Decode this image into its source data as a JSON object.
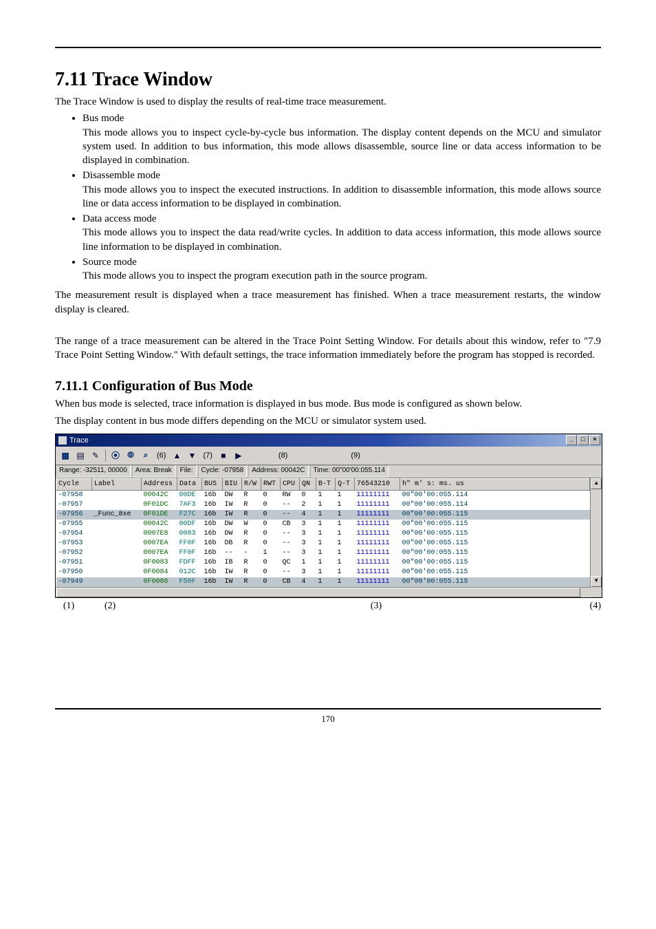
{
  "section": {
    "title": "7.11 Trace Window",
    "intro": "The Trace Window is used to display the results of real-time trace measurement.",
    "modes": [
      {
        "name": "Bus mode",
        "desc": "This mode allows you to inspect cycle-by-cycle bus information. The display content depends on the MCU and simulator system used. In addition to bus information, this mode allows disassemble, source line or data access information to be displayed in combination."
      },
      {
        "name": "Disassemble mode",
        "desc": "This mode allows you to inspect the executed instructions. In addition to disassemble information, this mode allows source line or data access information to be displayed in combination."
      },
      {
        "name": "Data access mode",
        "desc": "This mode allows you to inspect the data read/write cycles. In addition to data access information, this mode allows source line information to be displayed in combination."
      },
      {
        "name": "Source mode",
        "desc": "This mode allows you to inspect the program execution path in the source program."
      }
    ],
    "para2": "The measurement result is displayed when a trace measurement has finished. When a trace measurement restarts, the window display is cleared.",
    "para3": "The range of a trace measurement can be altered in the Trace Point Setting Window. For details about this window, refer to \"7.9 Trace Point Setting Window.\" With default settings, the trace information immediately before the program has stopped is recorded."
  },
  "subsection": {
    "title": "7.11.1 Configuration of Bus Mode",
    "p1": "When bus mode is selected, trace information is displayed in bus mode. Bus mode is configured as shown below.",
    "p2": "The display content in bus mode differs depending on the MCU or simulator system used."
  },
  "trace": {
    "title": "Trace",
    "winbtn_min": "_",
    "winbtn_max": "□",
    "winbtn_close": "×",
    "toolbar_callouts": {
      "left": "(6)",
      "r1": "(7)",
      "r2": "(8)",
      "r3": "(9)"
    },
    "status": {
      "range": "Range: -32511, 00000",
      "area": "Area: Break",
      "file": "File:",
      "cycle": "Cycle: -07958",
      "address": "Address: 00042C",
      "time": "Time: 00\"00'00:055.114"
    },
    "columns": [
      "Cycle",
      "Label",
      "Address",
      "Data",
      "BUS",
      "BIU",
      "R/W",
      "RWT",
      "CPU",
      "QN",
      "B-T",
      "Q-T",
      "76543210",
      "h\" m' s: ms. us"
    ],
    "rows": [
      {
        "cycle": "-07958",
        "label": "",
        "addr": "00042C",
        "data": "00DE",
        "bus": "16b",
        "biu": "DW",
        "rw": "R",
        "rwt": "0",
        "cpu": "RW",
        "qn": "0",
        "bt": "1",
        "qt": "1",
        "p": "11111111",
        "time": "00\"00'00:055.114",
        "hl": false
      },
      {
        "cycle": "-07957",
        "label": "",
        "addr": "0F01DC",
        "data": "7AF3",
        "bus": "16b",
        "biu": "IW",
        "rw": "R",
        "rwt": "0",
        "cpu": "--",
        "qn": "2",
        "bt": "1",
        "qt": "1",
        "p": "11111111",
        "time": "00\"00'00:055.114",
        "hl": false
      },
      {
        "cycle": "-07956",
        "label": "_Func_8xe",
        "addr": "0F01DE",
        "data": "F27C",
        "bus": "16b",
        "biu": "IW",
        "rw": "R",
        "rwt": "0",
        "cpu": "--",
        "qn": "4",
        "bt": "1",
        "qt": "1",
        "p": "11111111",
        "time": "00\"00'00:055.115",
        "hl": true
      },
      {
        "cycle": "-07955",
        "label": "",
        "addr": "00042C",
        "data": "00DF",
        "bus": "16b",
        "biu": "DW",
        "rw": "W",
        "rwt": "0",
        "cpu": "CB",
        "qn": "3",
        "bt": "1",
        "qt": "1",
        "p": "11111111",
        "time": "00\"00'00:055.115",
        "hl": false
      },
      {
        "cycle": "-07954",
        "label": "",
        "addr": "0007E8",
        "data": "0083",
        "bus": "16b",
        "biu": "DW",
        "rw": "R",
        "rwt": "0",
        "cpu": "--",
        "qn": "3",
        "bt": "1",
        "qt": "1",
        "p": "11111111",
        "time": "00\"00'00:055.115",
        "hl": false
      },
      {
        "cycle": "-07953",
        "label": "",
        "addr": "0007EA",
        "data": "FF0F",
        "bus": "16b",
        "biu": "DB",
        "rw": "R",
        "rwt": "0",
        "cpu": "--",
        "qn": "3",
        "bt": "1",
        "qt": "1",
        "p": "11111111",
        "time": "00\"00'00:055.115",
        "hl": false
      },
      {
        "cycle": "-07952",
        "label": "",
        "addr": "0007EA",
        "data": "FF0F",
        "bus": "16b",
        "biu": "--",
        "rw": "-",
        "rwt": "1",
        "cpu": "--",
        "qn": "3",
        "bt": "1",
        "qt": "1",
        "p": "11111111",
        "time": "00\"00'00:055.115",
        "hl": false
      },
      {
        "cycle": "-07951",
        "label": "",
        "addr": "0F0083",
        "data": "FDFF",
        "bus": "16b",
        "biu": "IB",
        "rw": "R",
        "rwt": "0",
        "cpu": "QC",
        "qn": "1",
        "bt": "1",
        "qt": "1",
        "p": "11111111",
        "time": "00\"00'00:055.115",
        "hl": false
      },
      {
        "cycle": "-07950",
        "label": "",
        "addr": "0F0084",
        "data": "012C",
        "bus": "16b",
        "biu": "IW",
        "rw": "R",
        "rwt": "0",
        "cpu": "--",
        "qn": "3",
        "bt": "1",
        "qt": "1",
        "p": "11111111",
        "time": "00\"00'00:055.115",
        "hl": false
      },
      {
        "cycle": "-07949",
        "label": "",
        "addr": "0F0086",
        "data": "F50F",
        "bus": "16b",
        "biu": "IW",
        "rw": "R",
        "rwt": "0",
        "cpu": "CB",
        "qn": "4",
        "bt": "1",
        "qt": "1",
        "p": "11111111",
        "time": "00\"00'00:055.115",
        "hl": true
      }
    ]
  },
  "callouts_below": {
    "c1": "(1)",
    "c2": "(2)",
    "c3": "(3)",
    "c4": "(4)"
  },
  "page_number": "170"
}
